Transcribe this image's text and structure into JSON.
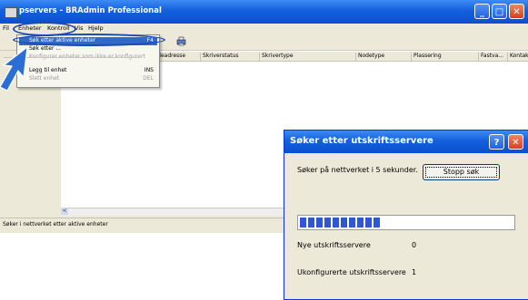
{
  "window": {
    "title": "pservers - BRAdmin Professional",
    "controls": {
      "minimize": "_",
      "maximize": "□",
      "close": "✕"
    }
  },
  "menubar": {
    "items": [
      "Fil",
      "Enheter",
      "Kontroll",
      "Vis",
      "Hjelp"
    ]
  },
  "columns": [
    "Nodeadresse",
    "Skriverstatus",
    "Skrivertype",
    "Nodetype",
    "Plassering",
    "Fastva...",
    "Kontakt"
  ],
  "dropdown": {
    "items": [
      {
        "label": "Søk etter aktive enheter",
        "shortcut": "F4",
        "state": "selected"
      },
      {
        "label": "Søk etter ...",
        "shortcut": "",
        "state": "normal"
      },
      {
        "label": "Konfigurer enheter som ikke er konfigurert",
        "shortcut": "",
        "state": "disabled"
      },
      {
        "label": "Legg til enhet",
        "shortcut": "INS",
        "state": "normal"
      },
      {
        "label": "Slett enhet",
        "shortcut": "DEL",
        "state": "disabled"
      }
    ]
  },
  "statusbar": {
    "text": "Søker i nettverket etter aktive enheter"
  },
  "scroll": {
    "left_arrow": "<"
  },
  "dialog": {
    "title": "Søker etter utskriftsservere",
    "help_glyph": "?",
    "close_glyph": "✕",
    "message": "Søker på nettverket i 5 sekunder.",
    "stop_button": "Stopp søk",
    "progress": {
      "filled_segments": 10,
      "segment_total": 31
    },
    "new_servers_label": "Nye utskriftsservere",
    "new_servers_value": "0",
    "unconfigured_label": "Ukonfigurerte utskriftsservere",
    "unconfigured_value": "1"
  },
  "colors": {
    "titlebar": "#1460dc",
    "selection": "#316ac5",
    "progress": "#2f57d4",
    "highlight_oval": "#1c4ab5"
  }
}
